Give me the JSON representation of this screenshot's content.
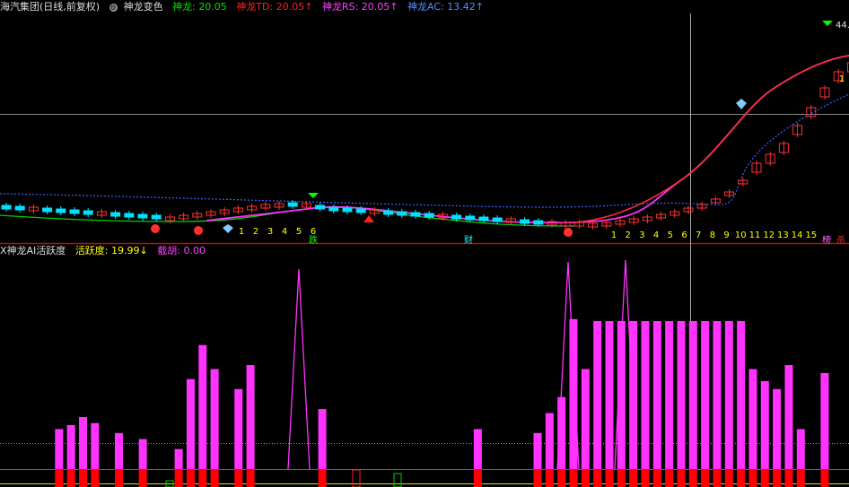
{
  "header_top": {
    "stock": "海汽集团(日线,前复权)",
    "indicator": "神龙变色",
    "v1": {
      "label": "神龙:",
      "value": "20.05",
      "color": "#00e000"
    },
    "v2": {
      "label": "神龙TD:",
      "value": "20.05↑",
      "color": "#ff2020"
    },
    "v3": {
      "label": "神龙RS:",
      "value": "20.05↑",
      "color": "#ff40ff"
    },
    "v4": {
      "label": "神龙AC:",
      "value": "13.42↑",
      "color": "#5a8cff"
    },
    "price_tag": "44."
  },
  "header_bottom": {
    "indicator": "X神龙AI活跃度",
    "v1": {
      "label": "活跃度:",
      "value": "19.99↓",
      "color": "#ffff00"
    },
    "v2": {
      "label": "截胡:",
      "value": "0.00",
      "color": "#ff40ff"
    }
  },
  "colors": {
    "up": "#ff3030",
    "down": "#00e0ff",
    "ma_pink": "#ff30ff",
    "ma_green": "#00d000",
    "ma_blue": "#4060ff",
    "bar_magenta": "#ff33ff",
    "bar_red": "#ff0000"
  },
  "chart_data": [
    {
      "type": "candlestick",
      "labels": {
        "first_sequence": [
          "1",
          "2",
          "3",
          "4",
          "5",
          "6"
        ],
        "second_sequence": [
          "1",
          "2",
          "3",
          "4",
          "5",
          "6",
          "7",
          "8",
          "9",
          "10",
          "11",
          "12",
          "13",
          "14",
          "15"
        ],
        "markers": [
          "跌",
          "财",
          "榜",
          "杀",
          "1"
        ]
      }
    },
    {
      "type": "bar",
      "series": [
        {
          "name": "活跃度",
          "values": [
            0,
            0,
            0,
            0,
            20,
            22,
            26,
            23,
            0,
            18,
            0,
            15,
            0,
            0,
            10,
            45,
            62,
            50,
            0,
            40,
            52,
            0,
            0,
            0,
            0,
            0,
            30,
            0,
            0,
            0,
            0,
            0,
            0,
            0,
            0,
            0,
            0,
            0,
            0,
            20,
            0,
            0,
            0,
            0,
            18,
            28,
            36,
            75,
            50,
            74,
            74,
            74,
            74,
            74,
            74,
            74,
            74,
            74,
            74,
            74,
            74,
            74,
            50,
            44,
            40,
            52,
            20,
            0,
            48
          ]
        },
        {
          "name": "截胡",
          "values": [
            0,
            0,
            0,
            0,
            0,
            0,
            0,
            0,
            0,
            0,
            0,
            0,
            0,
            0,
            0,
            0,
            0,
            0,
            0,
            0,
            100,
            0,
            0,
            0,
            0,
            0,
            0,
            0,
            0,
            0,
            0,
            0,
            0,
            0,
            0,
            0,
            0,
            0,
            0,
            0,
            100,
            0,
            0,
            100,
            0,
            0,
            0,
            0,
            0,
            0,
            0,
            0,
            0,
            0,
            0,
            0,
            0,
            0,
            0,
            0,
            0,
            0,
            0,
            0,
            0,
            0,
            0,
            0
          ]
        }
      ]
    }
  ]
}
